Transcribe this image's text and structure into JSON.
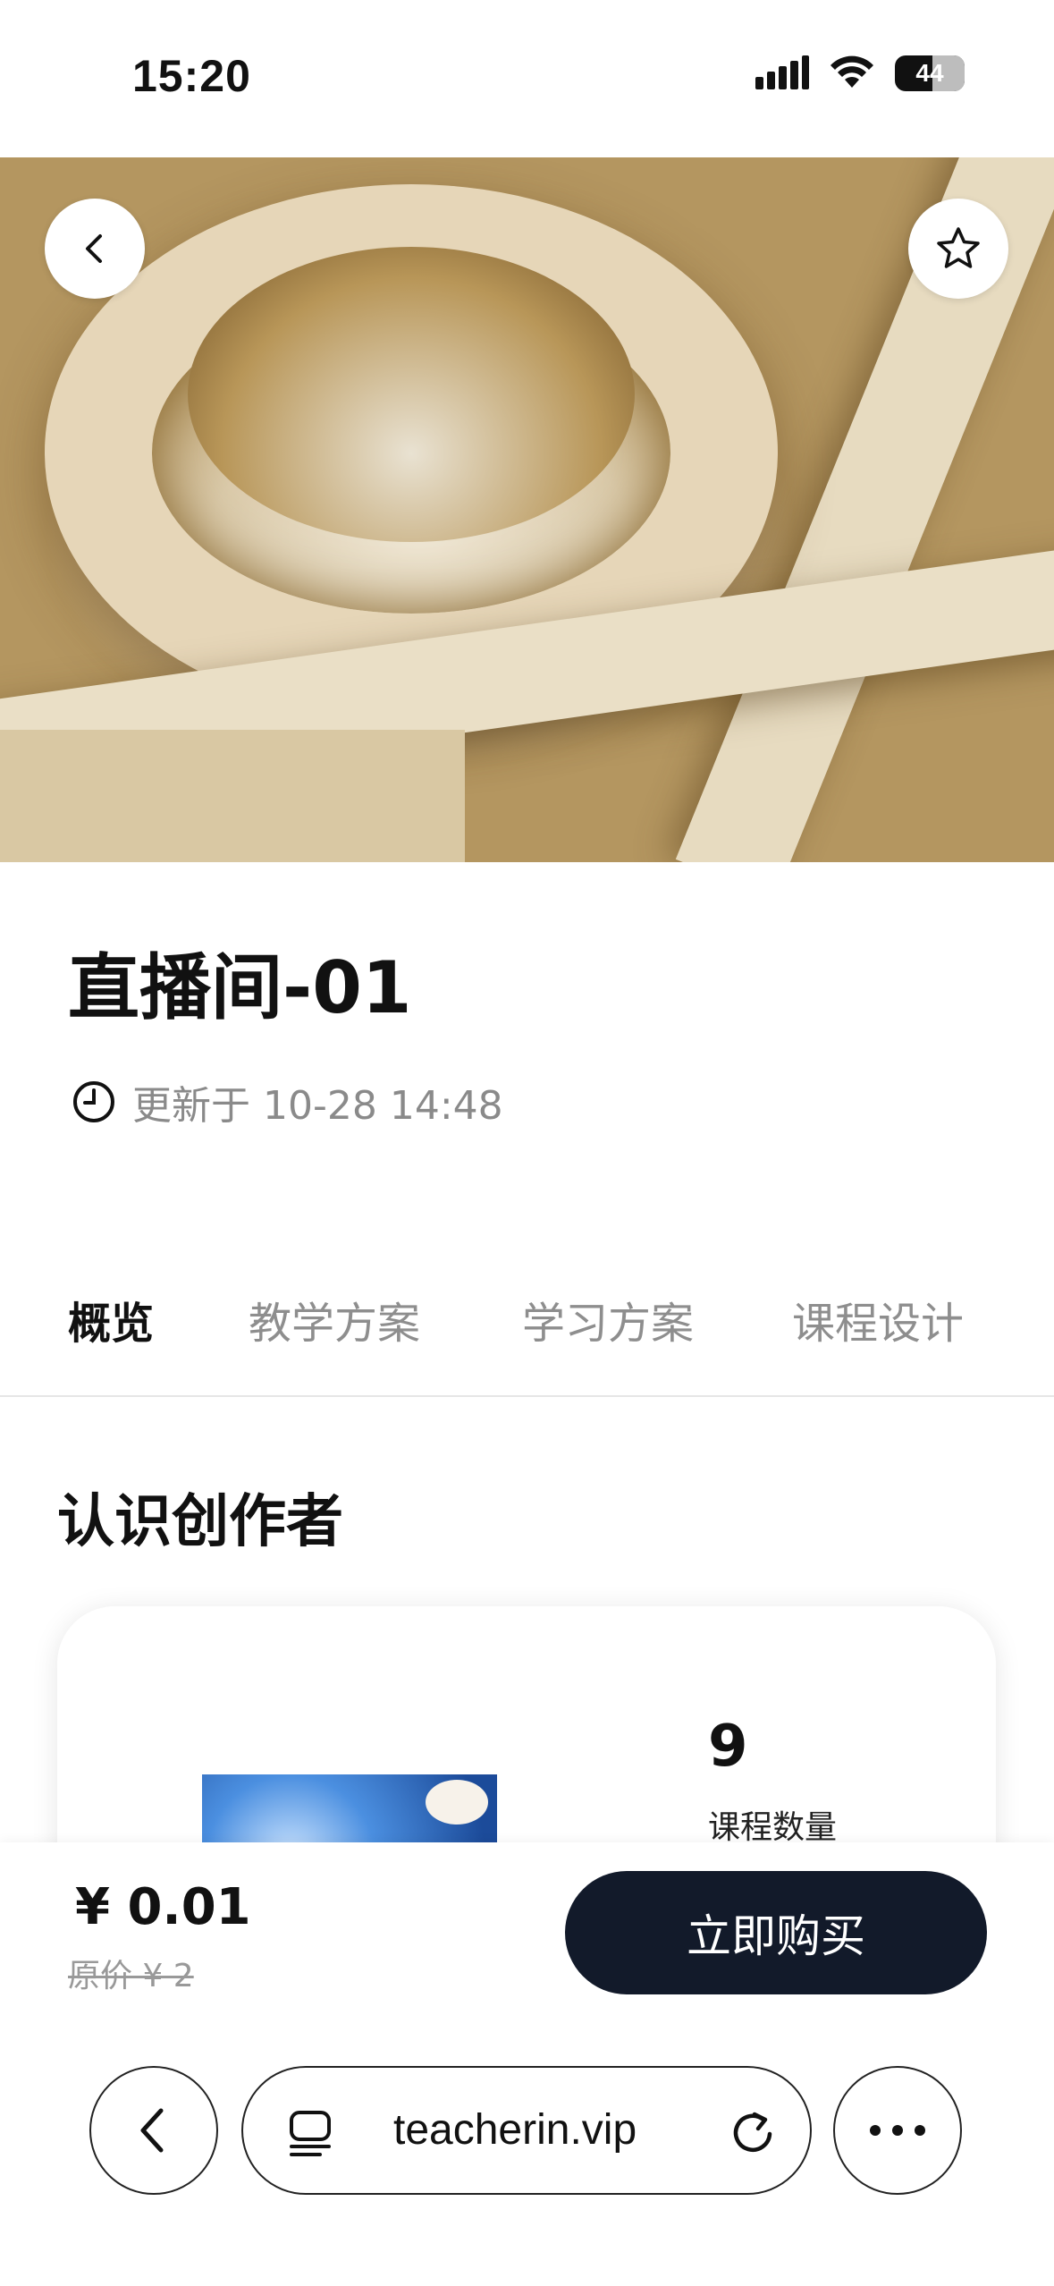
{
  "status_bar": {
    "time": "15:20",
    "battery": "44"
  },
  "course": {
    "title": "直播间-01",
    "updated_text": "更新于 10-28 14:48"
  },
  "tabs": [
    {
      "label": "概览",
      "active": true
    },
    {
      "label": "教学方案",
      "active": false
    },
    {
      "label": "学习方案",
      "active": false
    },
    {
      "label": "课程设计",
      "active": false
    }
  ],
  "creator_section": {
    "title": "认识创作者",
    "stat_value": "9",
    "stat_label": "课程数量"
  },
  "purchase": {
    "price": "¥ 0.01",
    "original_price": "原价 ¥ 2",
    "buy_label": "立即购买"
  },
  "browser": {
    "url": "teacherin.vip"
  },
  "colors": {
    "buy_button": "#121a2a",
    "muted_text": "#8a8a8a"
  }
}
